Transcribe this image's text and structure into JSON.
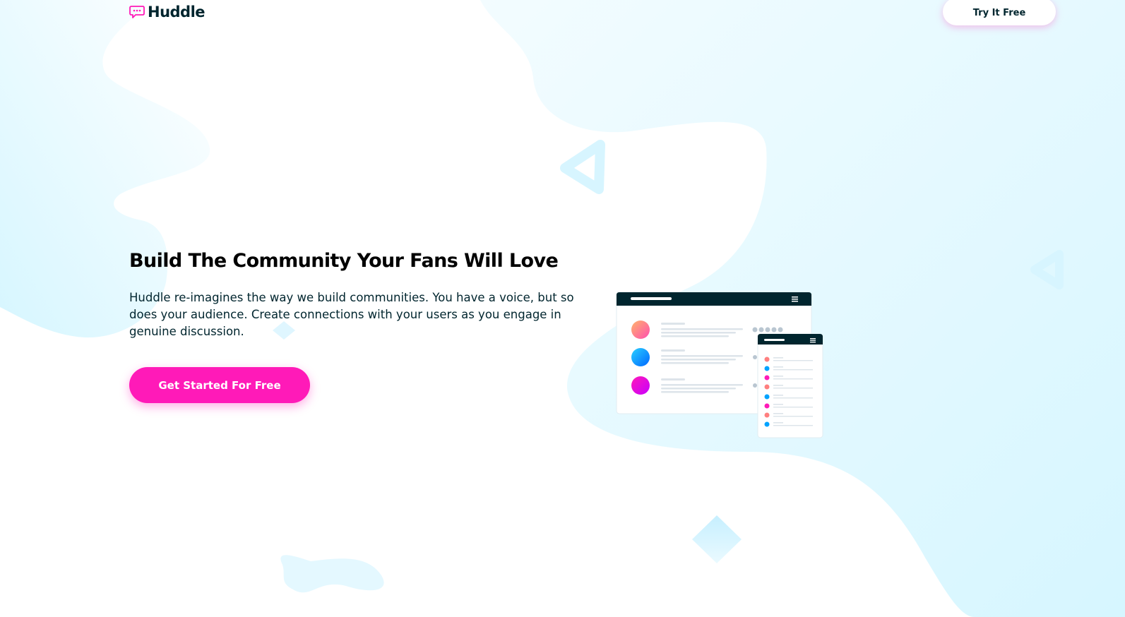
{
  "brand": {
    "name": "Huddle",
    "logo_icon": "chat-bubble-icon",
    "accent_color": "#ff1ab8",
    "dark_color": "#00252e",
    "blob_color": "#d9f7ff"
  },
  "header": {
    "cta_label": "Try It Free"
  },
  "hero": {
    "headline": "Build The Community Your Fans Will Love",
    "description": "Huddle re-imagines the way we build communities. You have a voice, but so does your audience. Create connections with your users as you engage in genuine discussion.",
    "cta_label": "Get Started For Free"
  },
  "illustration": {
    "name": "app-mockup-illustration",
    "avatar_colors": [
      "#ff7f7f",
      "#00a3ff",
      "#ff1ab8"
    ]
  }
}
